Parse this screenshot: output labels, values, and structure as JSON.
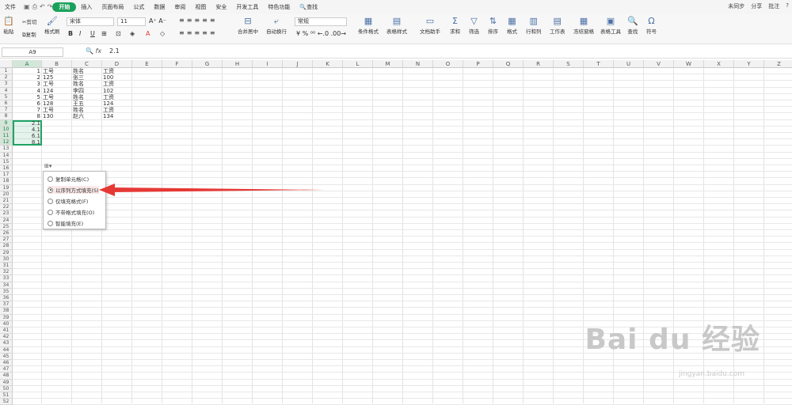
{
  "menu": {
    "file": "文件",
    "items": [
      "插入",
      "页面布局",
      "公式",
      "数据",
      "审阅",
      "视图",
      "安全",
      "开发工具",
      "特色功能"
    ],
    "active": "开始",
    "search": "查找",
    "right": [
      "未同步",
      "分享",
      "批注"
    ]
  },
  "ribbon": {
    "paste": "粘贴",
    "cut": "剪切",
    "copy": "复制",
    "format_painter": "格式刷",
    "font": "宋体",
    "size": "11",
    "numfmt": "常规",
    "merge": "合并居中",
    "wrap": "自动换行",
    "cond": "条件格式",
    "tablestyle": "表格样式",
    "doc": "文档助手",
    "sum": "求和",
    "filter": "筛选",
    "sort": "排序",
    "format": "格式",
    "rowcol": "行和列",
    "sheet": "工作表",
    "freeze": "冻结窗格",
    "tabletools": "表格工具",
    "find": "查找",
    "symbol": "符号"
  },
  "formula": {
    "name_box": "A9",
    "fx": "fx",
    "value": "2.1"
  },
  "columns": [
    "A",
    "B",
    "C",
    "D",
    "E",
    "F",
    "G",
    "H",
    "I",
    "J",
    "K",
    "L",
    "M",
    "N",
    "O",
    "P",
    "Q",
    "R",
    "S",
    "T",
    "U",
    "V",
    "W",
    "X",
    "Y",
    "Z"
  ],
  "rows": [
    {
      "a": "1",
      "b": "工号",
      "c": "姓名",
      "d": "工资"
    },
    {
      "a": "2",
      "b": "125",
      "c": "张三",
      "d": "100"
    },
    {
      "a": "3",
      "b": "工号",
      "c": "姓名",
      "d": "工资"
    },
    {
      "a": "4",
      "b": "124",
      "c": "李四",
      "d": "102"
    },
    {
      "a": "5",
      "b": "工号",
      "c": "姓名",
      "d": "工资"
    },
    {
      "a": "6",
      "b": "128",
      "c": "王五",
      "d": "124"
    },
    {
      "a": "7",
      "b": "工号",
      "c": "姓名",
      "d": "工资"
    },
    {
      "a": "8",
      "b": "130",
      "c": "赵六",
      "d": "134"
    },
    {
      "a": "2.1",
      "b": "",
      "c": "",
      "d": ""
    },
    {
      "a": "4.1",
      "b": "",
      "c": "",
      "d": ""
    },
    {
      "a": "6.1",
      "b": "",
      "c": "",
      "d": ""
    },
    {
      "a": "8.1",
      "b": "",
      "c": "",
      "d": ""
    }
  ],
  "row_count": 52,
  "fill_options": [
    "复制单元格(C)",
    "以序列方式填充(S)",
    "仅填充格式(F)",
    "不带格式填充(O)",
    "智能填充(E)"
  ],
  "selected_option": 1,
  "watermark": {
    "main": "Bai du 经验",
    "sub": "jingyan.baidu.com"
  },
  "colors": {
    "accent": "#1aa05a",
    "arrow": "#e53935"
  }
}
